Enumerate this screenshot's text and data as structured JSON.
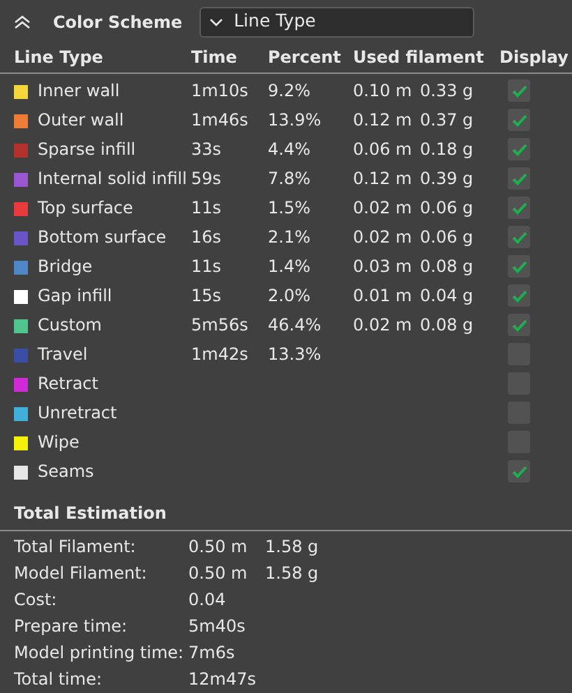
{
  "header": {
    "title": "Color Scheme",
    "dropdown": "Line Type"
  },
  "columns": [
    "Line Type",
    "Time",
    "Percent",
    "Used filament",
    "Display"
  ],
  "rows": [
    {
      "name": "Inner wall",
      "color": "#f5d53c",
      "time": "1m10s",
      "percent": "9.2%",
      "length": "0.10 m",
      "weight": "0.33 g",
      "checked": true
    },
    {
      "name": "Outer wall",
      "color": "#ef7c35",
      "time": "1m46s",
      "percent": "13.9%",
      "length": "0.12 m",
      "weight": "0.37 g",
      "checked": true
    },
    {
      "name": "Sparse infill",
      "color": "#b3312a",
      "time": "33s",
      "percent": "4.4%",
      "length": "0.06 m",
      "weight": "0.18 g",
      "checked": true
    },
    {
      "name": "Internal solid infill",
      "color": "#9a56d1",
      "time": "59s",
      "percent": "7.8%",
      "length": "0.12 m",
      "weight": "0.39 g",
      "checked": true
    },
    {
      "name": "Top surface",
      "color": "#e83a3a",
      "time": "11s",
      "percent": "1.5%",
      "length": "0.02 m",
      "weight": "0.06 g",
      "checked": true
    },
    {
      "name": "Bottom surface",
      "color": "#6a55c8",
      "time": "16s",
      "percent": "2.1%",
      "length": "0.02 m",
      "weight": "0.06 g",
      "checked": true
    },
    {
      "name": "Bridge",
      "color": "#4f86c6",
      "time": "11s",
      "percent": "1.4%",
      "length": "0.03 m",
      "weight": "0.08 g",
      "checked": true
    },
    {
      "name": "Gap infill",
      "color": "#ffffff",
      "time": "15s",
      "percent": "2.0%",
      "length": "0.01 m",
      "weight": "0.04 g",
      "checked": true
    },
    {
      "name": "Custom",
      "color": "#4fc48c",
      "time": "5m56s",
      "percent": "46.4%",
      "length": "0.02 m",
      "weight": "0.08 g",
      "checked": true
    },
    {
      "name": "Travel",
      "color": "#3b4ea6",
      "time": "1m42s",
      "percent": "13.3%",
      "checked": false
    },
    {
      "name": "Retract",
      "color": "#cf2ad6",
      "checked": false
    },
    {
      "name": "Unretract",
      "color": "#3fb0d8",
      "checked": false
    },
    {
      "name": "Wipe",
      "color": "#f5f10a",
      "checked": false
    },
    {
      "name": "Seams",
      "color": "#e6e6e6",
      "checked": true
    }
  ],
  "summary_title": "Total Estimation",
  "summary": [
    {
      "label": "Total Filament:",
      "value": "0.50 m",
      "value_2": "1.58 g"
    },
    {
      "label": "Model Filament:",
      "value": "0.50 m",
      "value_2": "1.58 g"
    },
    {
      "label": "Cost:",
      "value": "0.04"
    },
    {
      "label": "Prepare time:",
      "value": "5m40s"
    },
    {
      "label": "Model printing time:",
      "value": "7m6s"
    },
    {
      "label": "Total time:",
      "value": "12m47s"
    }
  ]
}
